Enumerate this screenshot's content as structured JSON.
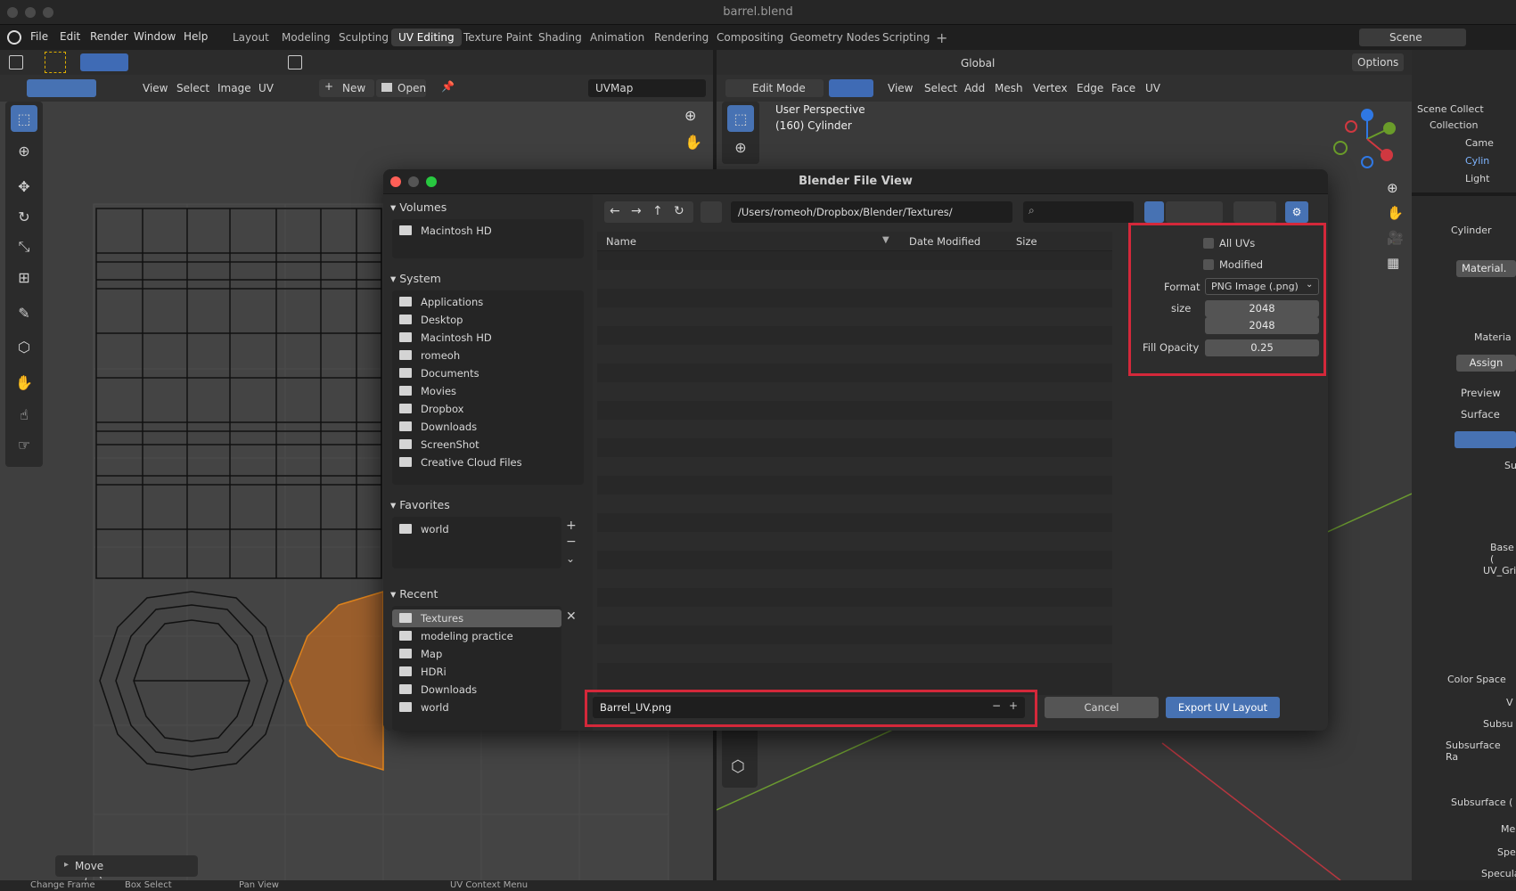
{
  "window": {
    "title": "barrel.blend"
  },
  "menu": [
    "File",
    "Edit",
    "Render",
    "Window",
    "Help"
  ],
  "workspaces": [
    "Layout",
    "Modeling",
    "Sculpting",
    "UV Editing",
    "Texture Paint",
    "Shading",
    "Animation",
    "Rendering",
    "Compositing",
    "Geometry Nodes",
    "Scripting"
  ],
  "active_workspace": "UV Editing",
  "scene": "Scene",
  "uv_header": {
    "view": "View",
    "select": "Select",
    "image": "Image",
    "uv": "UV",
    "new": "New",
    "open": "Open",
    "uvmap": "UVMap"
  },
  "vp_header": {
    "mode": "Edit Mode",
    "orientation": "Global",
    "options": "Options",
    "menus": [
      "View",
      "Select",
      "Add",
      "Mesh",
      "Vertex",
      "Edge",
      "Face",
      "UV"
    ]
  },
  "viewport": {
    "perspective": "User Perspective",
    "object": "(160) Cylinder"
  },
  "outliner": {
    "items": [
      "Scene Collect",
      "Collection",
      "Came",
      "Cylin",
      "Light"
    ]
  },
  "properties": {
    "object": "Cylinder",
    "material": "Material.",
    "material2": "Materia",
    "assign": "Assign",
    "preview": "Preview",
    "surface": "Surface",
    "su": "Su",
    "base": "Base (",
    "uvgrid": "UV_Gri",
    "color_space": "Color Space",
    "v": "V",
    "subsurface": "Subsu",
    "subsurface_r": "Subsurface Ra",
    "subsurface_c": "Subsurface (",
    "me": "Me",
    "spe": "Spe",
    "specular": "Specular"
  },
  "dialog": {
    "title": "Blender File View",
    "path": "/Users/romeoh/Dropbox/Blender/Textures/",
    "columns": {
      "name": "Name",
      "date": "Date Modified",
      "size": "Size"
    },
    "volumes": {
      "header": "Volumes",
      "items": [
        "Macintosh HD"
      ]
    },
    "system": {
      "header": "System",
      "items": [
        "Applications",
        "Desktop",
        "Macintosh HD",
        "romeoh",
        "Documents",
        "Movies",
        "Dropbox",
        "Downloads",
        "ScreenShot",
        "Creative Cloud Files"
      ]
    },
    "favorites": {
      "header": "Favorites",
      "items": [
        "world"
      ]
    },
    "recent": {
      "header": "Recent",
      "items": [
        "Textures",
        "modeling practice",
        "Map",
        "HDRi",
        "Downloads",
        "world"
      ]
    },
    "options": {
      "all_uvs": "All UVs",
      "modified": "Modified",
      "format_label": "Format",
      "format_value": "PNG Image (.png)",
      "size_label": "size",
      "size_x": "2048",
      "size_y": "2048",
      "fill_label": "Fill Opacity",
      "fill_value": "0.25"
    },
    "filename": "Barrel_UV.png",
    "cancel": "Cancel",
    "export": "Export UV Layout"
  },
  "move_panel": "Move",
  "status": [
    "Change Frame",
    "Box Select",
    "Pan View",
    "UV Context Menu"
  ]
}
